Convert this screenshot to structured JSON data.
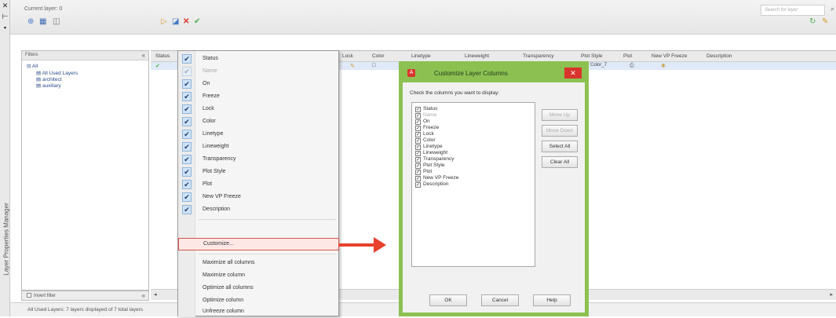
{
  "window": {
    "side_title": "Layer Properties Manager",
    "current_layer": "Current layer: 0",
    "search_placeholder": "Search for layer"
  },
  "toolbar": {
    "left": [
      "new-property-filter-icon",
      "new-group-filter-icon",
      "layer-states-icon"
    ],
    "right": [
      "new-layer-icon",
      "new-layer-vp-frozen-icon",
      "delete-layer-icon",
      "set-current-icon"
    ],
    "refresh": "refresh-icon",
    "settings": "settings-icon"
  },
  "filters": {
    "header": "Filters",
    "items": [
      "All",
      "All Used Layers",
      "architect",
      "auxiliary"
    ],
    "invert_label": "Invert filter"
  },
  "grid": {
    "columns": [
      "Status",
      "Lock",
      "Color",
      "Linetype",
      "Lineweight",
      "Transparency",
      "Plot Style",
      "Plot",
      "New VP Freeze",
      "Description"
    ],
    "row": {
      "linetype": "Conti...",
      "lineweight": "Default",
      "transparency": "0",
      "plot_style": "Color_7"
    }
  },
  "status_bar": "All Used Layers: 7 layers displayed of 7 total layers",
  "context_menu": {
    "column_items": [
      {
        "label": "Status",
        "checked": true,
        "enabled": true
      },
      {
        "label": "Name",
        "checked": true,
        "enabled": false
      },
      {
        "label": "On",
        "checked": true,
        "enabled": true
      },
      {
        "label": "Freeze",
        "checked": true,
        "enabled": true
      },
      {
        "label": "Lock",
        "checked": true,
        "enabled": true
      },
      {
        "label": "Color",
        "checked": true,
        "enabled": true
      },
      {
        "label": "Linetype",
        "checked": true,
        "enabled": true
      },
      {
        "label": "Lineweight",
        "checked": true,
        "enabled": true
      },
      {
        "label": "Transparency",
        "checked": true,
        "enabled": true
      },
      {
        "label": "Plot Style",
        "checked": true,
        "enabled": true
      },
      {
        "label": "Plot",
        "checked": true,
        "enabled": true
      },
      {
        "label": "New VP Freeze",
        "checked": true,
        "enabled": true
      },
      {
        "label": "Description",
        "checked": true,
        "enabled": true
      }
    ],
    "customize": "Customize...",
    "actions": [
      "Maximize all columns",
      "Maximize column",
      "Optimize all columns",
      "Optimize column",
      "Unfreeze column"
    ]
  },
  "dialog": {
    "title": "Customize Layer Columns",
    "prompt": "Check the columns you want to display:",
    "items": [
      {
        "label": "Status",
        "checked": true,
        "enabled": true
      },
      {
        "label": "Name",
        "checked": true,
        "enabled": false
      },
      {
        "label": "On",
        "checked": true,
        "enabled": true
      },
      {
        "label": "Freeze",
        "checked": true,
        "enabled": true
      },
      {
        "label": "Lock",
        "checked": true,
        "enabled": true
      },
      {
        "label": "Color",
        "checked": true,
        "enabled": true
      },
      {
        "label": "Linetype",
        "checked": true,
        "enabled": true
      },
      {
        "label": "Lineweight",
        "checked": true,
        "enabled": true
      },
      {
        "label": "Transparency",
        "checked": true,
        "enabled": true
      },
      {
        "label": "Plot Style",
        "checked": true,
        "enabled": true
      },
      {
        "label": "Plot",
        "checked": true,
        "enabled": true
      },
      {
        "label": "New VP Freeze",
        "checked": true,
        "enabled": true
      },
      {
        "label": "Description",
        "checked": true,
        "enabled": true
      }
    ],
    "move_up": "Move Up",
    "move_down": "Move Down",
    "select_all": "Select All",
    "clear_all": "Clear All",
    "ok": "OK",
    "cancel": "Cancel",
    "help": "Help"
  },
  "colors": {
    "dialog_frame": "#8cc152",
    "highlight_arrow": "#e8412c",
    "close_button": "#d9342b",
    "menu_check": "#cfe3f7"
  }
}
